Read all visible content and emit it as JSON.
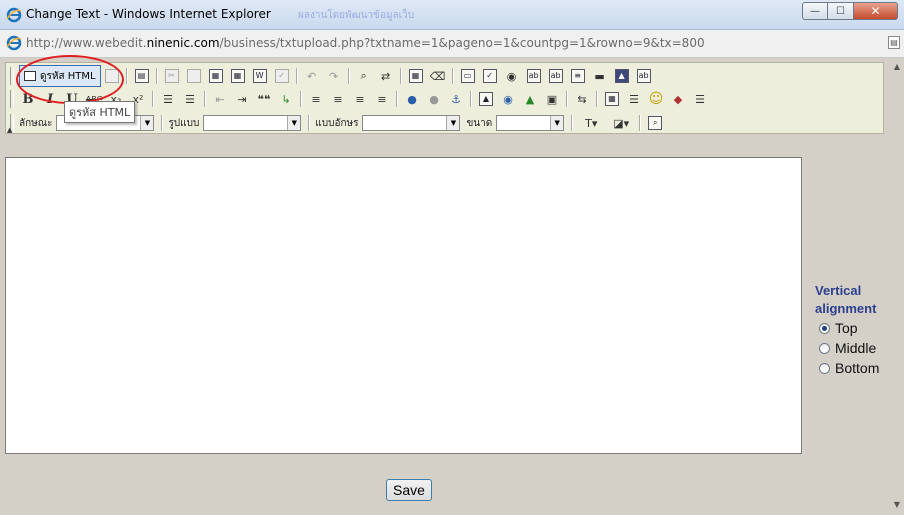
{
  "window": {
    "title": "Change Text - Windows Internet Explorer",
    "ghost_text": "ผลงานโดยพัฒนาข้อมูลเว็บ",
    "minimize": "—",
    "maximize": "☐",
    "close": "✕"
  },
  "address": {
    "prefix": "http://www.webedit.",
    "domain": "ninenic.com",
    "path": "/business/txtupload.php?txtname=1&pageno=1&countpg=1&rowno=9&tx=800"
  },
  "toolbar": {
    "source_label": "ดูรหัส HTML",
    "tooltip": "ดูรหัส HTML",
    "style_label": "ลักษณะ",
    "format_label": "รูปแบบ",
    "font_label": "แบบอักษร",
    "size_label": "ขนาด",
    "bold": "B",
    "italic": "I",
    "underline": "U",
    "strike": "ABC",
    "subscript": "x₂",
    "superscript": "x²",
    "quote": "❝❝",
    "smiley": "☺"
  },
  "valign": {
    "heading": "Vertical alignment",
    "options": [
      {
        "label": "Top",
        "checked": true
      },
      {
        "label": "Middle",
        "checked": false
      },
      {
        "label": "Bottom",
        "checked": false
      }
    ]
  },
  "save_label": "Save"
}
